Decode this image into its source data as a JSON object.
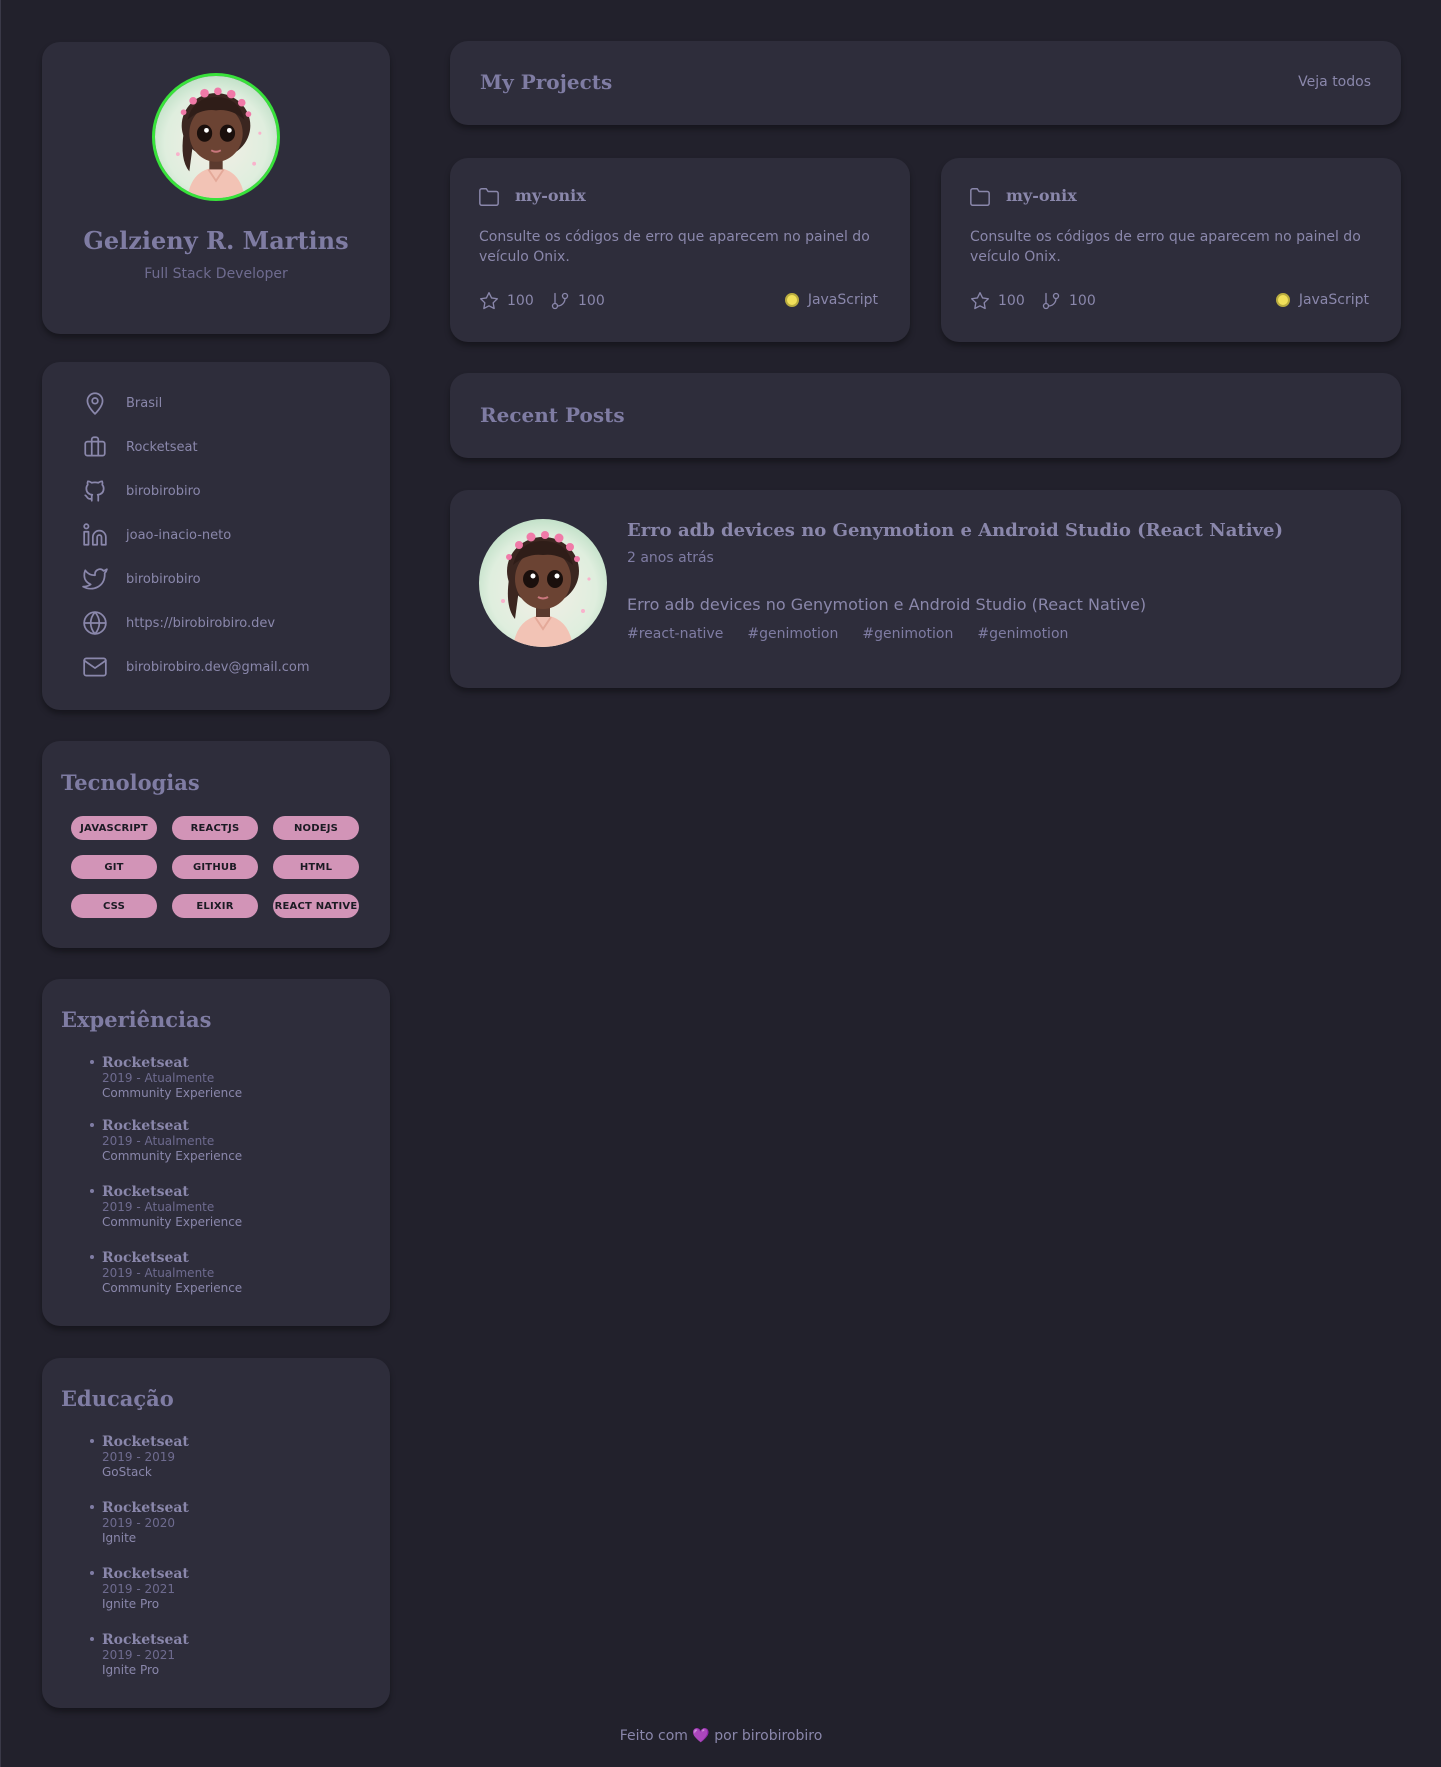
{
  "profile": {
    "name": "Gelzieny R. Martins",
    "role": "Full Stack Developer"
  },
  "contacts": [
    {
      "icon": "map-pin-icon",
      "label": "Brasil"
    },
    {
      "icon": "briefcase-icon",
      "label": "Rocketseat"
    },
    {
      "icon": "github-icon",
      "label": "birobirobiro"
    },
    {
      "icon": "linkedin-icon",
      "label": "joao-inacio-neto"
    },
    {
      "icon": "twitter-icon",
      "label": "birobirobiro"
    },
    {
      "icon": "globe-icon",
      "label": "https://birobirobiro.dev"
    },
    {
      "icon": "mail-icon",
      "label": "birobirobiro.dev@gmail.com"
    }
  ],
  "technologies": {
    "title": "Tecnologias",
    "items": [
      "JAVASCRIPT",
      "REACTJS",
      "NODEJS",
      "GIT",
      "GITHUB",
      "HTML",
      "CSS",
      "ELIXIR",
      "REACT NATIVE"
    ]
  },
  "experiences": {
    "title": "Experiências",
    "items": [
      {
        "org": "Rocketseat",
        "period": "2019 - Atualmente",
        "desc": "Community Experience"
      },
      {
        "org": "Rocketseat",
        "period": "2019 - Atualmente",
        "desc": "Community Experience"
      },
      {
        "org": "Rocketseat",
        "period": "2019 - Atualmente",
        "desc": "Community Experience"
      },
      {
        "org": "Rocketseat",
        "period": "2019 - Atualmente",
        "desc": "Community Experience"
      }
    ]
  },
  "education": {
    "title": "Educação",
    "items": [
      {
        "org": "Rocketseat",
        "period": "2019 - 2019",
        "desc": "GoStack"
      },
      {
        "org": "Rocketseat",
        "period": "2019 - 2020",
        "desc": "Ignite"
      },
      {
        "org": "Rocketseat",
        "period": "2019 - 2021",
        "desc": "Ignite Pro"
      },
      {
        "org": "Rocketseat",
        "period": "2019 - 2021",
        "desc": "Ignite Pro"
      }
    ]
  },
  "projects": {
    "title": "My Projects",
    "see_all": "Veja todos",
    "items": [
      {
        "name": "my-onix",
        "description": "Consulte os códigos de erro que aparecem no painel do veículo Onix.",
        "stars": "100",
        "forks": "100",
        "language": "JavaScript",
        "language_color": "#f1e05a"
      },
      {
        "name": "my-onix",
        "description": "Consulte os códigos de erro que aparecem no painel do veículo Onix.",
        "stars": "100",
        "forks": "100",
        "language": "JavaScript",
        "language_color": "#f1e05a"
      }
    ]
  },
  "posts": {
    "title": "Recent Posts",
    "items": [
      {
        "title": "Erro adb devices no Genymotion e Android Studio (React Native)",
        "time": "2 anos atrás",
        "body": "Erro adb devices no Genymotion e Android Studio (React Native)",
        "tags": [
          "#react-native",
          "#genimotion",
          "#genimotion",
          "#genimotion"
        ]
      }
    ]
  },
  "footer": {
    "prefix": "Feito com",
    "heart": "💜",
    "suffix": "por birobirobiro"
  },
  "colors": {
    "background": "#22212c",
    "card": "#2e2d3b",
    "pill": "#d294b7",
    "avatar_ring": "#38e23a"
  }
}
